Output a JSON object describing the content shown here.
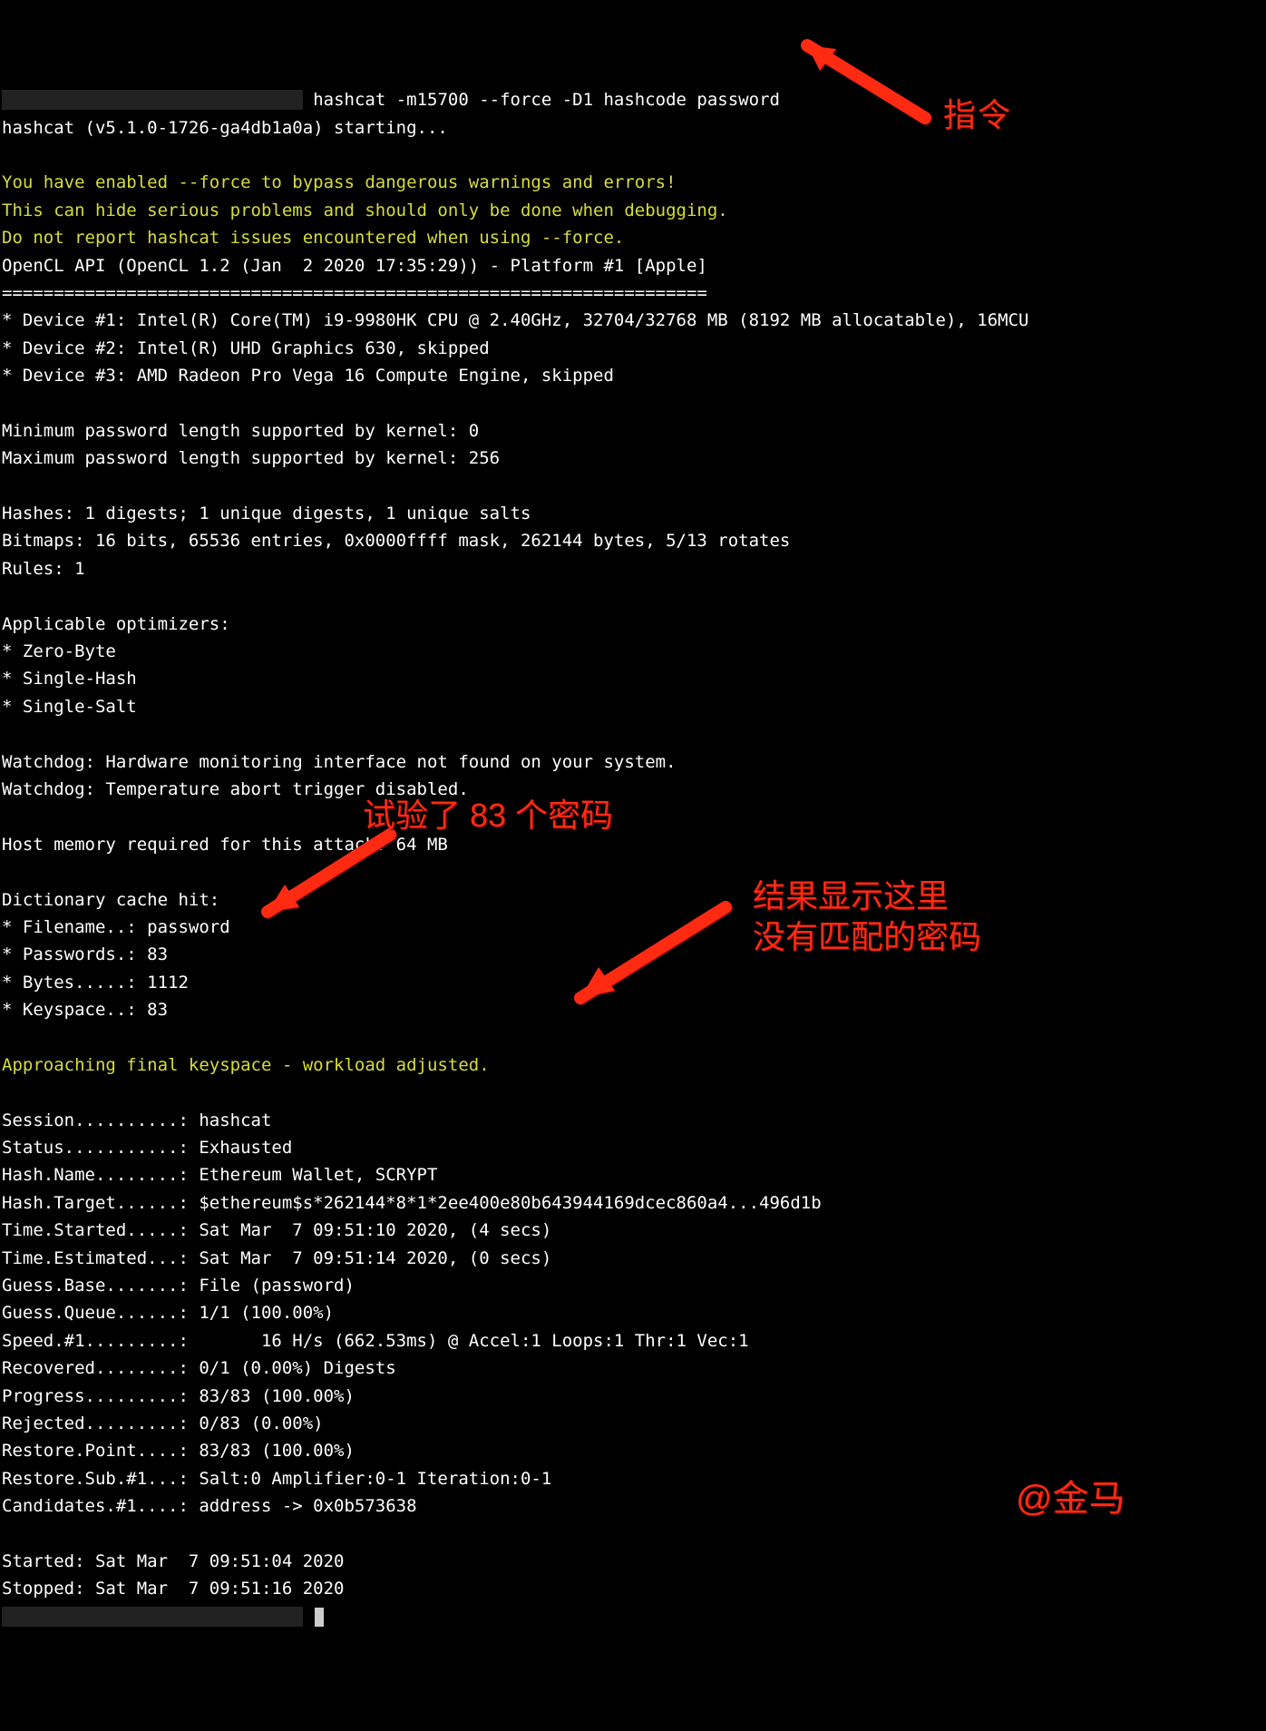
{
  "prompt": {
    "redacted": "█████████████████████████████",
    "suffix": ""
  },
  "cmd": "hashcat -m15700 --force -D1 hashcode password",
  "starting": "hashcat (v5.1.0-1726-ga4db1a0a) starting...",
  "warn": {
    "l1": "You have enabled --force to bypass dangerous warnings and errors!",
    "l2": "This can hide serious problems and should only be done when debugging.",
    "l3": "Do not report hashcat issues encountered when using --force."
  },
  "opencl": "OpenCL API (OpenCL 1.2 (Jan  2 2020 17:35:29)) - Platform #1 [Apple]",
  "sep": "====================================================================",
  "dev": {
    "d1": "* Device #1: Intel(R) Core(TM) i9-9980HK CPU @ 2.40GHz, 32704/32768 MB (8192 MB allocatable), 16MCU",
    "d2": "* Device #2: Intel(R) UHD Graphics 630, skipped",
    "d3": "* Device #3: AMD Radeon Pro Vega 16 Compute Engine, skipped"
  },
  "limits": {
    "min": "Minimum password length supported by kernel: 0",
    "max": "Maximum password length supported by kernel: 256"
  },
  "info": {
    "hashes": "Hashes: 1 digests; 1 unique digests, 1 unique salts",
    "bitmaps": "Bitmaps: 16 bits, 65536 entries, 0x0000ffff mask, 262144 bytes, 5/13 rotates",
    "rules": "Rules: 1"
  },
  "opt": {
    "head": "Applicable optimizers:",
    "o1": "* Zero-Byte",
    "o2": "* Single-Hash",
    "o3": "* Single-Salt"
  },
  "watch": {
    "w1": "Watchdog: Hardware monitoring interface not found on your system.",
    "w2": "Watchdog: Temperature abort trigger disabled."
  },
  "hostmem": "Host memory required for this attack: 64 MB",
  "dict": {
    "head": "Dictionary cache hit:",
    "file": "* Filename..: password",
    "pwds": "* Passwords.: 83",
    "bytes": "* Bytes.....: 1112",
    "keys": "* Keyspace..: 83"
  },
  "approaching": "Approaching final keyspace - workload adjusted.",
  "status": {
    "session": "Session..........: hashcat",
    "status": "Status...........: Exhausted",
    "hashname": "Hash.Name........: Ethereum Wallet, SCRYPT",
    "hashtarget": "Hash.Target......: $ethereum$s*262144*8*1*2ee400e80b643944169dcec860a4...496d1b",
    "timestarted": "Time.Started.....: Sat Mar  7 09:51:10 2020, (4 secs)",
    "timeest": "Time.Estimated...: Sat Mar  7 09:51:14 2020, (0 secs)",
    "guessbase": "Guess.Base.......: File (password)",
    "guessqueue": "Guess.Queue......: 1/1 (100.00%)",
    "speed": "Speed.#1.........:       16 H/s (662.53ms) @ Accel:1 Loops:1 Thr:1 Vec:1",
    "recovered": "Recovered........: 0/1 (0.00%) Digests",
    "progress": "Progress.........: 83/83 (100.00%)",
    "rejected": "Rejected.........: 0/83 (0.00%)",
    "restorepoint": "Restore.Point....: 83/83 (100.00%)",
    "restoresub": "Restore.Sub.#1...: Salt:0 Amplifier:0-1 Iteration:0-1",
    "candidates": "Candidates.#1....: address -> 0x0b573638"
  },
  "timing": {
    "started": "Started: Sat Mar  7 09:51:04 2020",
    "stopped": "Stopped: Sat Mar  7 09:51:16 2020"
  },
  "annotations": {
    "a1": "指令",
    "a2": "试验了 83 个密码",
    "a3_l1": "结果显示这里",
    "a3_l2": "没有匹配的密码",
    "sig": "@金马"
  }
}
